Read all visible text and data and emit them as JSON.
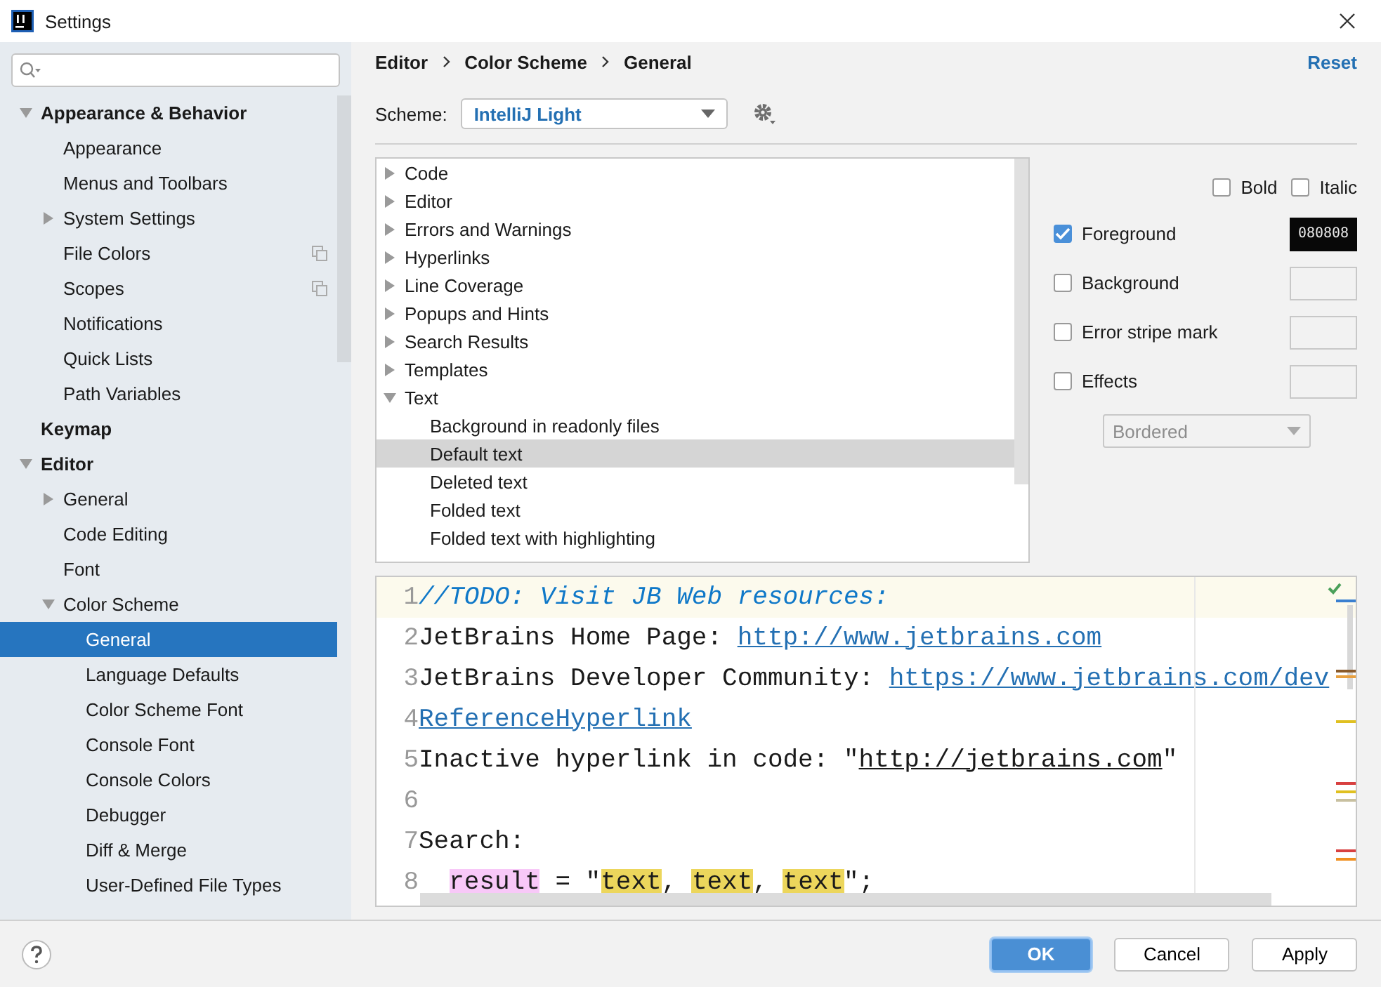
{
  "window": {
    "title": "Settings"
  },
  "sidebar": {
    "items": [
      {
        "label": "Appearance & Behavior",
        "expanded": true,
        "selected": false,
        "children": [
          {
            "label": "Appearance",
            "selected": false,
            "project_scoped": false
          },
          {
            "label": "Menus and Toolbars",
            "selected": false,
            "project_scoped": false
          },
          {
            "label": "System Settings",
            "expanded": false,
            "selected": false,
            "project_scoped": false
          },
          {
            "label": "File Colors",
            "selected": false,
            "project_scoped": true
          },
          {
            "label": "Scopes",
            "selected": false,
            "project_scoped": true
          },
          {
            "label": "Notifications",
            "selected": false,
            "project_scoped": false
          },
          {
            "label": "Quick Lists",
            "selected": false,
            "project_scoped": false
          },
          {
            "label": "Path Variables",
            "selected": false,
            "project_scoped": false
          }
        ]
      },
      {
        "label": "Keymap",
        "selected": false
      },
      {
        "label": "Editor",
        "expanded": true,
        "selected": false,
        "children": [
          {
            "label": "General",
            "expanded": false,
            "selected": false
          },
          {
            "label": "Code Editing",
            "selected": false
          },
          {
            "label": "Font",
            "selected": false
          },
          {
            "label": "Color Scheme",
            "expanded": true,
            "selected": false,
            "children": [
              {
                "label": "General",
                "selected": true
              },
              {
                "label": "Language Defaults",
                "selected": false
              },
              {
                "label": "Color Scheme Font",
                "selected": false
              },
              {
                "label": "Console Font",
                "selected": false
              },
              {
                "label": "Console Colors",
                "selected": false
              },
              {
                "label": "Debugger",
                "selected": false
              },
              {
                "label": "Diff & Merge",
                "selected": false
              },
              {
                "label": "User-Defined File Types",
                "selected": false
              }
            ]
          }
        ]
      }
    ]
  },
  "breadcrumb": [
    "Editor",
    "Color Scheme",
    "General"
  ],
  "reset": "Reset",
  "scheme": {
    "label": "Scheme:",
    "value": "IntelliJ Light"
  },
  "attributes_tree": [
    {
      "label": "Code",
      "expanded": false,
      "selected": false
    },
    {
      "label": "Editor",
      "expanded": false,
      "selected": false
    },
    {
      "label": "Errors and Warnings",
      "expanded": false,
      "selected": false
    },
    {
      "label": "Hyperlinks",
      "expanded": false,
      "selected": false
    },
    {
      "label": "Line Coverage",
      "expanded": false,
      "selected": false
    },
    {
      "label": "Popups and Hints",
      "expanded": false,
      "selected": false
    },
    {
      "label": "Search Results",
      "expanded": false,
      "selected": false
    },
    {
      "label": "Templates",
      "expanded": false,
      "selected": false
    },
    {
      "label": "Text",
      "expanded": true,
      "selected": false,
      "children": [
        {
          "label": "Background in readonly files",
          "selected": false
        },
        {
          "label": "Default text",
          "selected": true
        },
        {
          "label": "Deleted text",
          "selected": false
        },
        {
          "label": "Folded text",
          "selected": false
        },
        {
          "label": "Folded text with highlighting",
          "selected": false
        }
      ]
    }
  ],
  "font_style": [
    {
      "label": "Bold",
      "checked": false
    },
    {
      "label": "Italic",
      "checked": false
    }
  ],
  "color_options": [
    {
      "label": "Foreground",
      "checked": true,
      "value": "080808"
    },
    {
      "label": "Background",
      "checked": false
    },
    {
      "label": "Error stripe mark",
      "checked": false
    },
    {
      "label": "Effects",
      "checked": false
    }
  ],
  "effect_type": {
    "value": "Bordered",
    "disabled": true
  },
  "preview": {
    "lines": [
      {
        "number": "1",
        "current": true,
        "indented": false,
        "segments": [
          {
            "kind": "comment",
            "text": "//TODO: Visit JB Web resources:"
          }
        ]
      },
      {
        "number": "2",
        "current": false,
        "indented": false,
        "segments": [
          {
            "kind": "plain",
            "text": "JetBrains Home Page: "
          },
          {
            "kind": "link",
            "text": "http://www.jetbrains.com"
          }
        ]
      },
      {
        "number": "3",
        "current": false,
        "indented": false,
        "segments": [
          {
            "kind": "plain",
            "text": "JetBrains Developer Community: "
          },
          {
            "kind": "link",
            "text": "https://www.jetbrains.com/dev"
          }
        ]
      },
      {
        "number": "4",
        "current": false,
        "indented": false,
        "segments": [
          {
            "kind": "link",
            "text": "ReferenceHyperlink"
          }
        ]
      },
      {
        "number": "5",
        "current": false,
        "indented": false,
        "segments": [
          {
            "kind": "plain",
            "text": "Inactive hyperlink in code: \""
          },
          {
            "kind": "inactive_link",
            "text": "http://jetbrains.com"
          },
          {
            "kind": "plain",
            "text": "\""
          }
        ]
      },
      {
        "number": "6",
        "current": false
      },
      {
        "number": "7",
        "current": false,
        "indented": false,
        "segments": [
          {
            "kind": "plain",
            "text": "Search:"
          }
        ]
      },
      {
        "number": "8",
        "current": false,
        "indented": true,
        "segments": [
          {
            "kind": "search",
            "text": "result"
          },
          {
            "kind": "plain",
            "text": " = \""
          },
          {
            "kind": "match",
            "text": "text"
          },
          {
            "kind": "plain",
            "text": ", "
          },
          {
            "kind": "match",
            "text": "text"
          },
          {
            "kind": "plain",
            "text": ", "
          },
          {
            "kind": "match",
            "text": "text"
          },
          {
            "kind": "plain",
            "text": "\";"
          }
        ]
      }
    ]
  },
  "buttons": [
    {
      "label": "OK",
      "default": true
    },
    {
      "label": "Cancel",
      "default": false
    },
    {
      "label": "Apply",
      "default": false
    }
  ]
}
